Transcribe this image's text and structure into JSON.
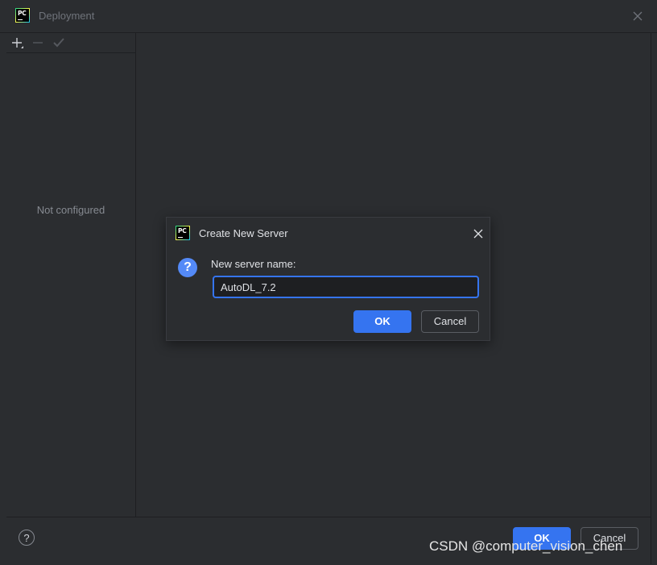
{
  "window": {
    "title": "Deployment"
  },
  "icons": {
    "app": "pycharm-logo",
    "app_text": "PC",
    "close": "close-icon",
    "add": "plus-icon",
    "remove": "minus-icon",
    "apply": "check-icon",
    "help": "help-icon",
    "question": "question-icon"
  },
  "left_panel": {
    "empty_text": "Not configured"
  },
  "footer": {
    "help_glyph": "?",
    "ok_label": "OK",
    "cancel_label": "Cancel"
  },
  "dialog": {
    "title": "Create New Server",
    "question_glyph": "?",
    "field_label": "New server name:",
    "field_value": "AutoDL_7.2",
    "ok_label": "OK",
    "cancel_label": "Cancel"
  },
  "watermark": "CSDN @computer_vision_chen",
  "colors": {
    "background": "#2b2d30",
    "accent": "#3574f0",
    "question_icon": "#548af7"
  }
}
